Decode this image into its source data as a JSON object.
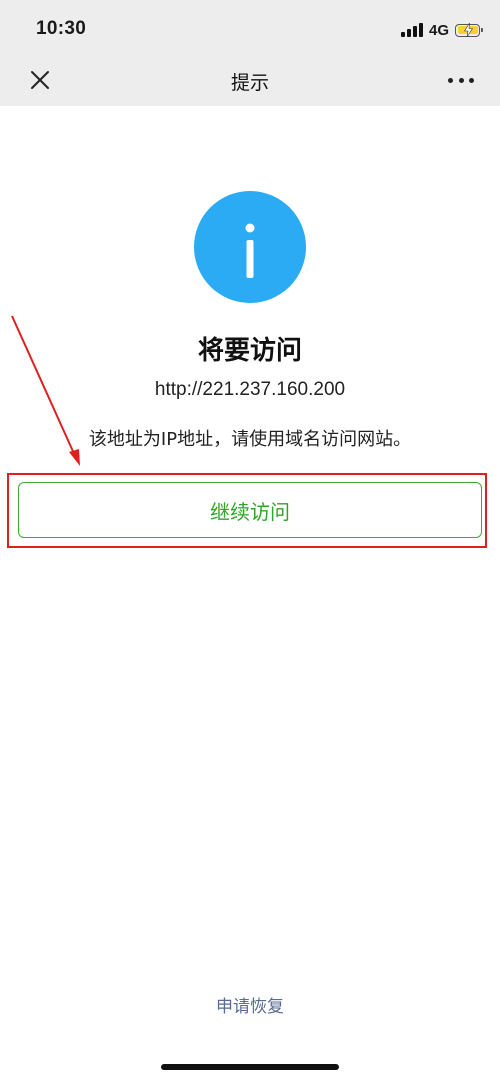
{
  "status_bar": {
    "time": "10:30",
    "network": "4G",
    "battery_state": "charging"
  },
  "nav": {
    "title": "提示",
    "close_icon": "close-icon",
    "more_icon": "more-icon"
  },
  "content": {
    "icon": "info-icon",
    "icon_color": "#2aabf3",
    "heading": "将要访问",
    "url": "http://221.237.160.200",
    "description": "该地址为IP地址，请使用域名访问网站。",
    "continue_button": "继续访问",
    "accent_color": "#3cb034"
  },
  "footer": {
    "apply_link": "申请恢复"
  },
  "annotation": {
    "highlight_color": "#e0201f"
  }
}
